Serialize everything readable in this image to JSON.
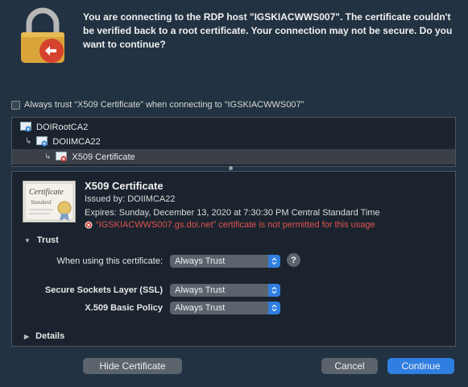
{
  "dialog": {
    "message": "You are connecting to the RDP host \"IGSKIACWWS007\". The certificate couldn't be verified back to a root certificate. Your connection may not be secure. Do you want to continue?",
    "always_trust_label": "Always trust “X509 Certificate” when connecting to “IGSKIACWWS007”"
  },
  "tree": {
    "items": [
      {
        "label": "DOIRootCA2",
        "icon": "cert-icon"
      },
      {
        "label": "DOIIMCA22",
        "icon": "cert-icon"
      },
      {
        "label": "X509 Certificate",
        "icon": "cert-error-icon"
      }
    ]
  },
  "certificate": {
    "title": "X509 Certificate",
    "issued_by": "Issued by: DOIIMCA22",
    "expires": "Expires: Sunday, December 13, 2020 at 7:30:30 PM Central Standard Time",
    "error": "“IGSKIACWWS007.gs.doi.net” certificate is not permitted for this usage",
    "icon_caption_1": "Certificate",
    "icon_caption_2": "Standard"
  },
  "trust": {
    "section_label": "Trust",
    "when_using_label": "When using this certificate:",
    "when_using_value": "Always Trust",
    "ssl_label": "Secure Sockets Layer (SSL)",
    "ssl_value": "Always Trust",
    "basic_policy_label": "X.509 Basic Policy",
    "basic_policy_value": "Always Trust",
    "help": "?"
  },
  "details": {
    "section_label": "Details"
  },
  "buttons": {
    "hide_certificate": "Hide Certificate",
    "cancel": "Cancel",
    "continue": "Continue"
  },
  "colors": {
    "background": "#223242",
    "accent": "#2f7fe0",
    "error": "#e0524f"
  }
}
